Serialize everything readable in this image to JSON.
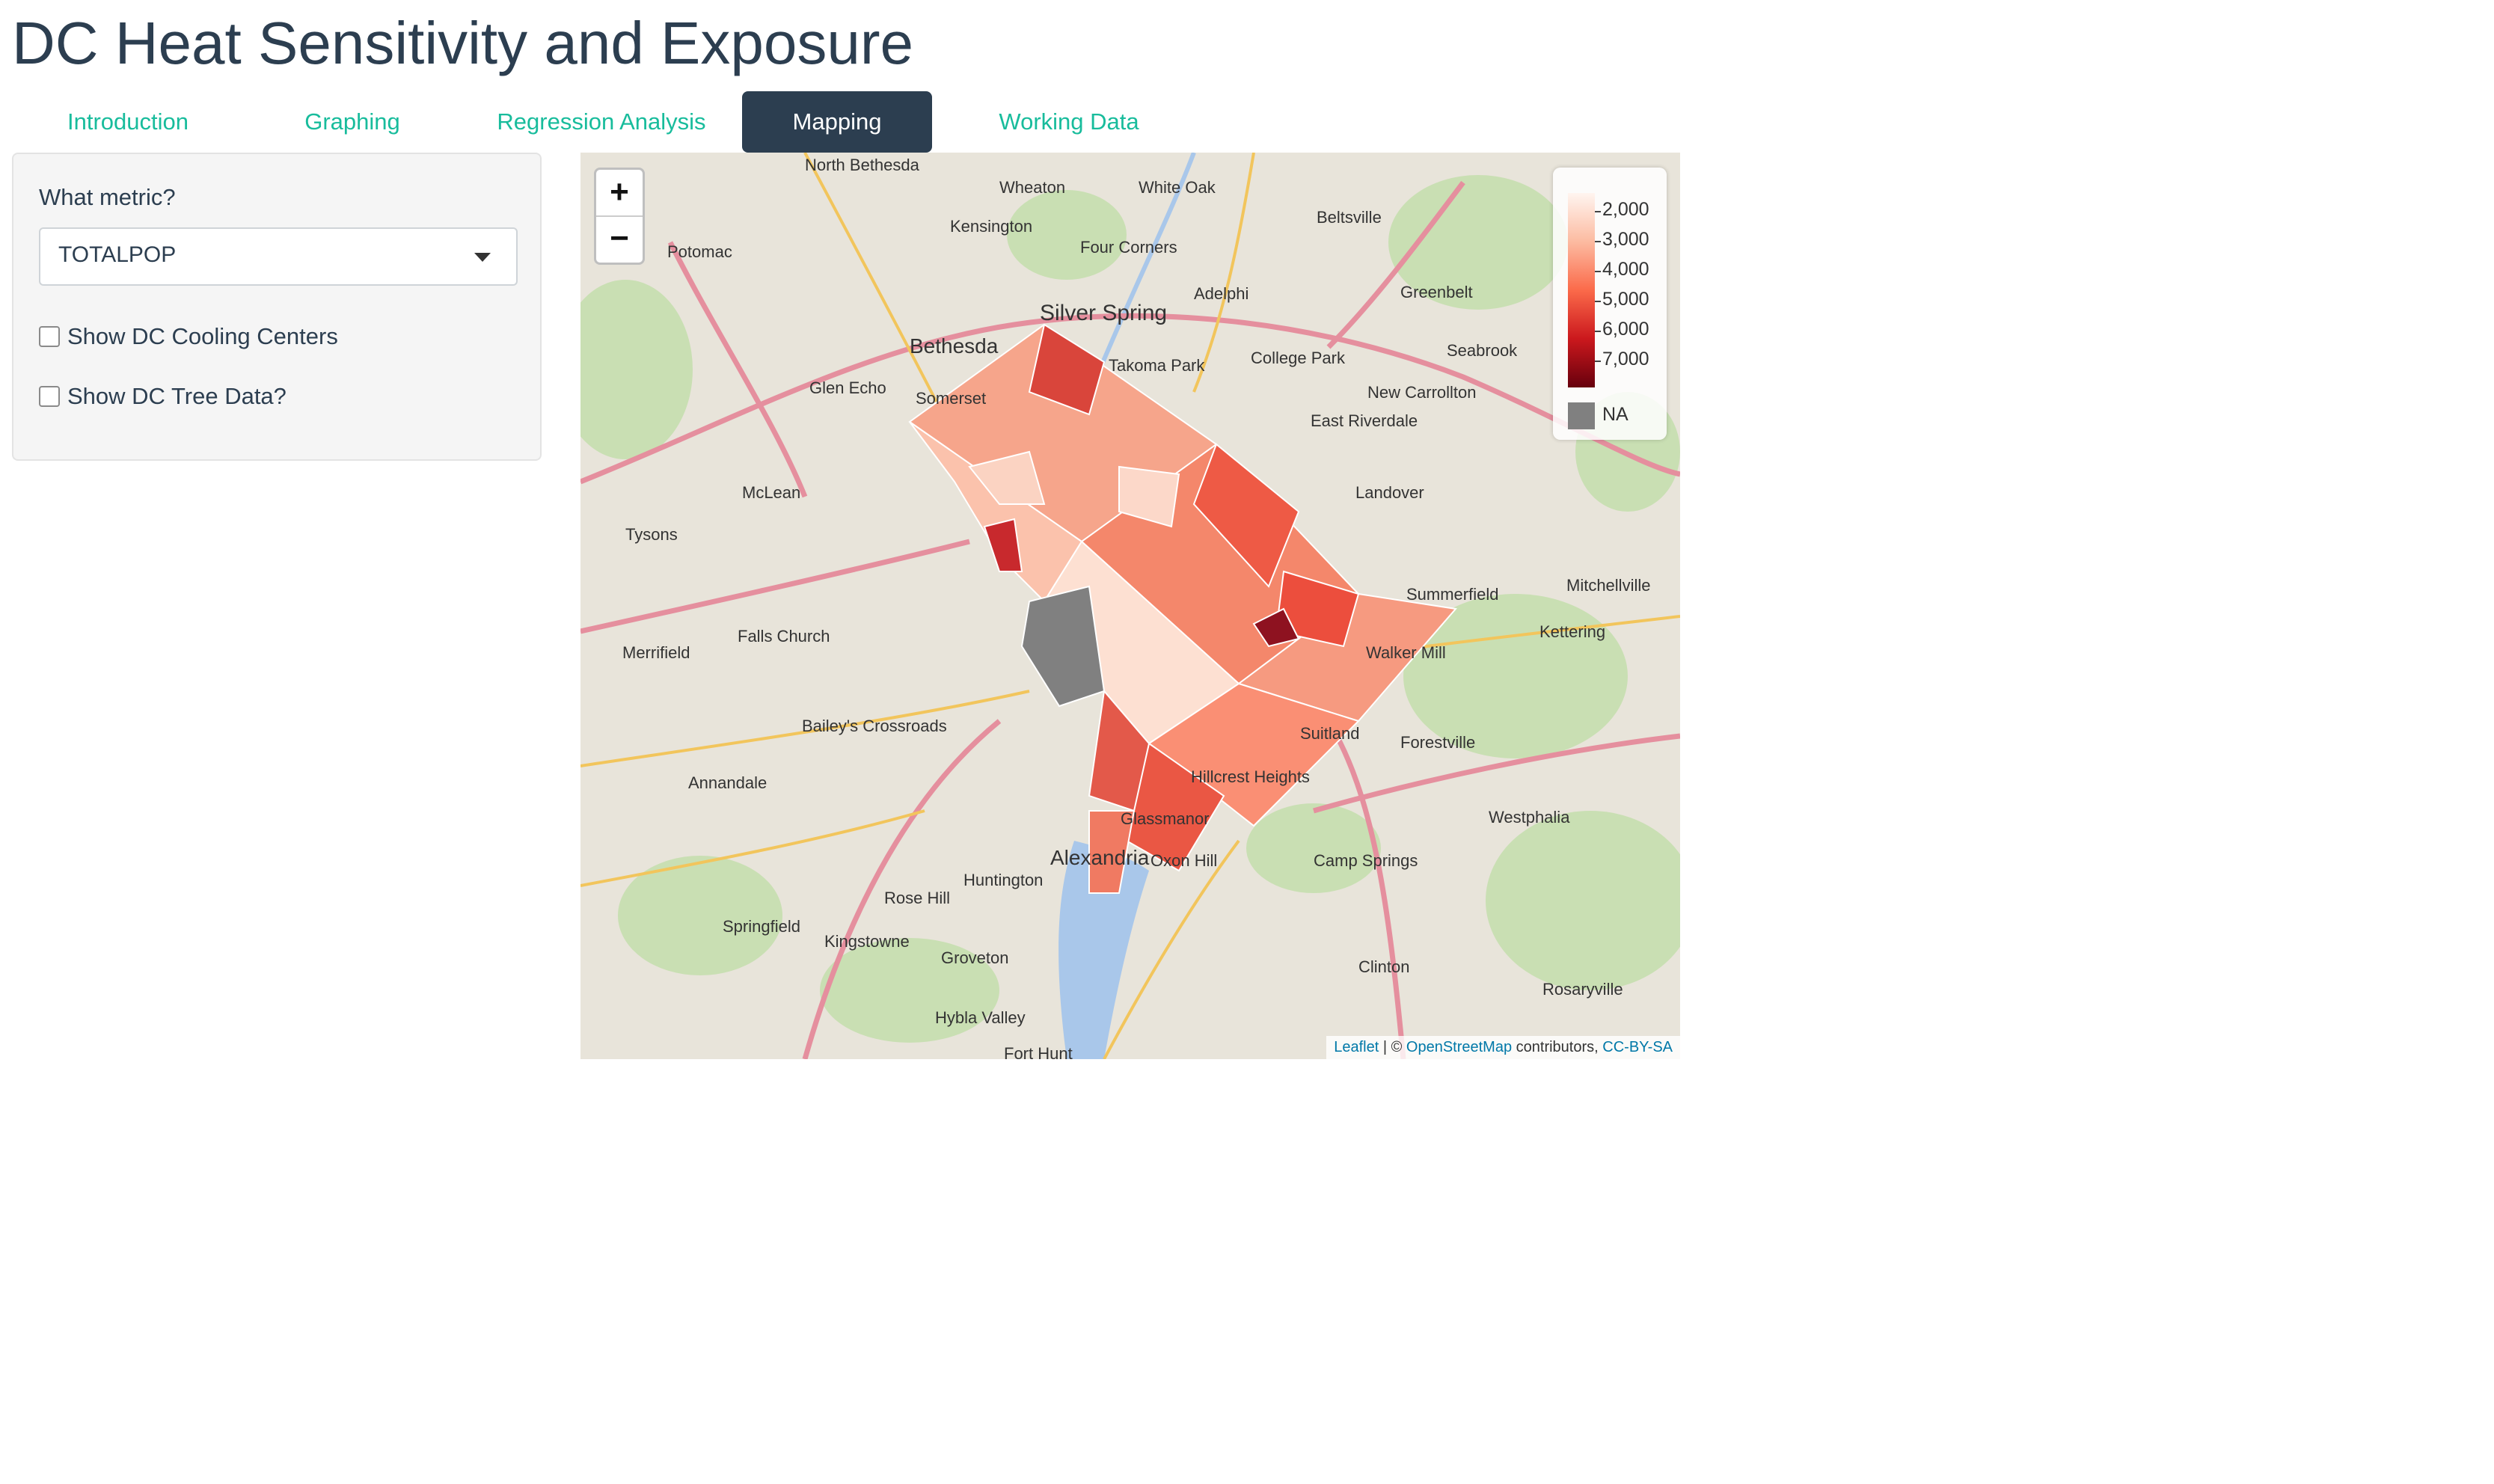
{
  "app": {
    "title": "DC Heat Sensitivity and Exposure"
  },
  "tabs": [
    {
      "label": "Introduction",
      "active": false
    },
    {
      "label": "Graphing",
      "active": false
    },
    {
      "label": "Regression Analysis",
      "active": false
    },
    {
      "label": "Mapping",
      "active": true
    },
    {
      "label": "Working Data",
      "active": false
    }
  ],
  "sidebar": {
    "metric_label": "What metric?",
    "metric_selected": "TOTALPOP",
    "cooling_centers_label": "Show DC Cooling Centers",
    "cooling_centers_checked": false,
    "tree_data_label": "Show DC Tree Data?",
    "tree_data_checked": false
  },
  "map": {
    "zoom_in": "+",
    "zoom_out": "−",
    "place_labels": [
      "North Bethesda",
      "Wheaton",
      "White Oak",
      "Beltsville",
      "Kensington",
      "Four Corners",
      "Potomac",
      "Silver Spring",
      "Adelphi",
      "Greenbelt",
      "Bethesda",
      "Takoma Park",
      "College Park",
      "Seabrook",
      "Glen Echo",
      "Somerset",
      "New Carrollton",
      "East Riverdale",
      "McLean",
      "Landover",
      "Tysons",
      "Mitchellville",
      "Summerfield",
      "Falls Church",
      "Merrifield",
      "Walker Mill",
      "Kettering",
      "Bailey's Crossroads",
      "Suitland",
      "Forestville",
      "Annandale",
      "Hillcrest Heights",
      "Westphalia",
      "Glassmanor",
      "Oxon Hill",
      "Camp Springs",
      "Alexandria",
      "Huntington",
      "Rose Hill",
      "Springfield",
      "Kingstowne",
      "Groveton",
      "Clinton",
      "Rosaryville",
      "Hybla Valley",
      "Fort Hunt"
    ],
    "legend": {
      "labels": [
        "2,000",
        "3,000",
        "4,000",
        "5,000",
        "6,000",
        "7,000"
      ],
      "na_label": "NA",
      "colors": [
        "#fff5f0",
        "#fcbba1",
        "#fb6a4a",
        "#cb181d",
        "#67000d"
      ],
      "na_color": "#808080"
    },
    "attribution": {
      "leaflet": "Leaflet",
      "sep": " | © ",
      "osm": "OpenStreetMap",
      "contributors": " contributors, ",
      "license": "CC-BY-SA"
    }
  }
}
